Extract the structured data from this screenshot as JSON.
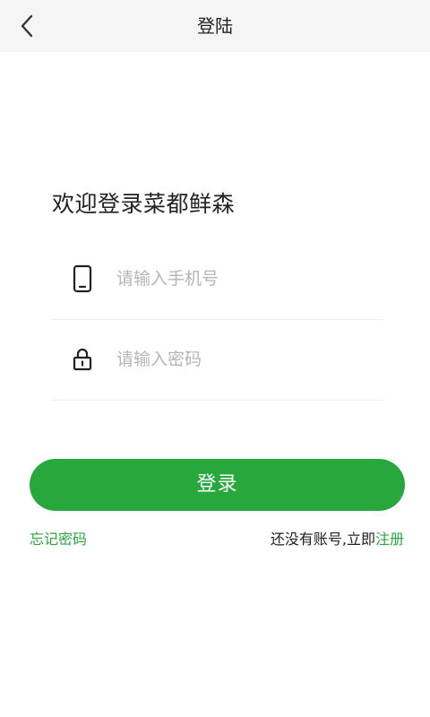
{
  "header": {
    "title": "登陆",
    "back_icon": "chevron-left-icon"
  },
  "welcome_text": "欢迎登录菜都鲜森",
  "phone_field": {
    "placeholder": "请输入手机号",
    "value": "",
    "icon": "phone-icon"
  },
  "password_field": {
    "placeholder": "请输入密码",
    "value": "",
    "icon": "lock-icon"
  },
  "login_button": {
    "label": "登录"
  },
  "forgot_password": {
    "label": "忘记密码"
  },
  "register": {
    "prompt": "还没有账号,立即",
    "link_label": "注册"
  },
  "colors": {
    "accent": "#27a73c",
    "header_bg": "#f5f5f5",
    "text_primary": "#222222",
    "placeholder": "#b5b5b5",
    "divider": "#efefef"
  }
}
